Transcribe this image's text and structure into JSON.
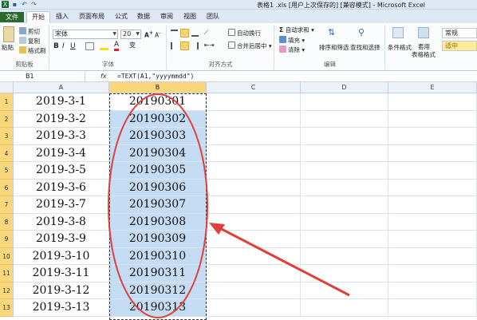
{
  "titlebar": {
    "title": "表格1 .xls [用户上次保存的] [兼容模式] - Microsoft Excel"
  },
  "tabs": [
    "文件",
    "开始",
    "插入",
    "页面布局",
    "公式",
    "数据",
    "审阅",
    "视图",
    "团队"
  ],
  "ribbon": {
    "clipboard": {
      "paste": "粘贴",
      "cut": "剪切",
      "copy": "复制",
      "format_painter": "格式刷",
      "label": "剪贴板"
    },
    "font": {
      "name": "宋体",
      "size": "20",
      "label": "字体"
    },
    "alignment": {
      "wrap": "自动换行",
      "merge": "合并后居中",
      "label": "对齐方式"
    },
    "editing": {
      "autosum": "自动求和",
      "fill": "填充",
      "clear": "清除",
      "sort_filter": "排序和筛选",
      "find_select": "查找和选择",
      "label": "编辑"
    },
    "styles": {
      "conditional": "条件格式",
      "table": "套用",
      "table2": "表格格式",
      "normal": "常规",
      "neutral": "适中"
    }
  },
  "formula_bar": {
    "name_box": "B1",
    "fx": "fx",
    "formula": "=TEXT(A1,\"yyyymmdd\")"
  },
  "columns": [
    "A",
    "B",
    "C",
    "D",
    "E"
  ],
  "rows": [
    {
      "num": "1",
      "a": "2019-3-1",
      "b": "20190301"
    },
    {
      "num": "2",
      "a": "2019-3-2",
      "b": "20190302"
    },
    {
      "num": "3",
      "a": "2019-3-3",
      "b": "20190303"
    },
    {
      "num": "4",
      "a": "2019-3-4",
      "b": "20190304"
    },
    {
      "num": "5",
      "a": "2019-3-5",
      "b": "20190305"
    },
    {
      "num": "6",
      "a": "2019-3-6",
      "b": "20190306"
    },
    {
      "num": "7",
      "a": "2019-3-7",
      "b": "20190307"
    },
    {
      "num": "8",
      "a": "2019-3-8",
      "b": "20190308"
    },
    {
      "num": "9",
      "a": "2019-3-9",
      "b": "20190309"
    },
    {
      "num": "10",
      "a": "2019-3-10",
      "b": "20190310"
    },
    {
      "num": "11",
      "a": "2019-3-11",
      "b": "20190311"
    },
    {
      "num": "12",
      "a": "2019-3-12",
      "b": "20190312"
    },
    {
      "num": "13",
      "a": "2019-3-13",
      "b": "20190313"
    }
  ],
  "colors": {
    "annotation": "#e0403a",
    "selection": "#c5dcf5",
    "header_highlight": "#f9d77a"
  }
}
